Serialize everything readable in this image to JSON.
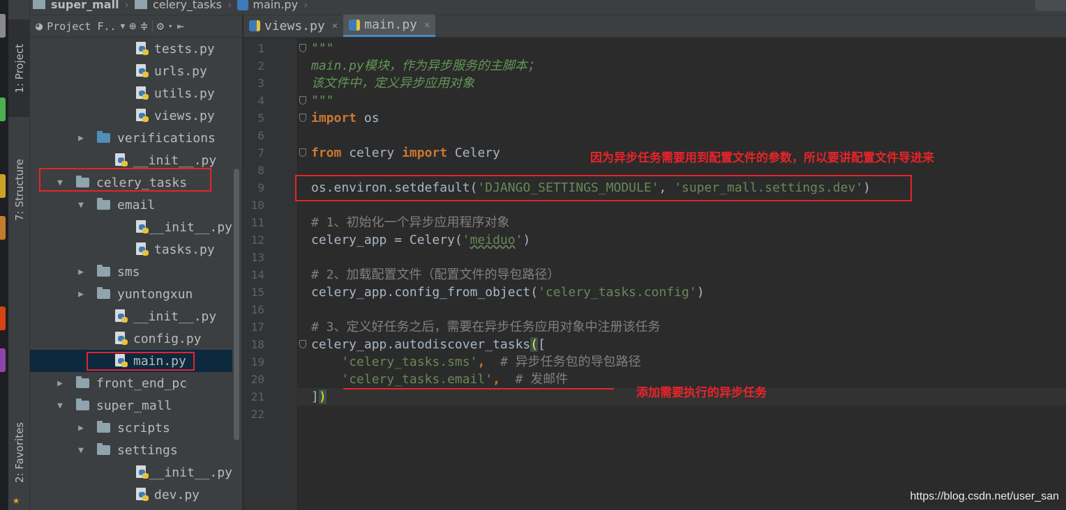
{
  "breadcrumb": [
    "super_mall",
    "celery_tasks",
    "main.py"
  ],
  "side_tabs": [
    "1: Project",
    "7: Structure",
    "2: Favorites"
  ],
  "project_panel": {
    "title": "Project F..",
    "tree": [
      {
        "label": "tests.py",
        "type": "file",
        "depth": 4,
        "expand": ""
      },
      {
        "label": "urls.py",
        "type": "file",
        "depth": 4,
        "expand": ""
      },
      {
        "label": "utils.py",
        "type": "file",
        "depth": 4,
        "expand": ""
      },
      {
        "label": "views.py",
        "type": "file",
        "depth": 4,
        "expand": ""
      },
      {
        "label": "verifications",
        "type": "pkg",
        "depth": 2,
        "expand": "collapsed"
      },
      {
        "label": "__init__.py",
        "type": "file",
        "depth": 3,
        "expand": ""
      },
      {
        "label": "celery_tasks",
        "type": "folder",
        "depth": 1,
        "expand": "expanded"
      },
      {
        "label": "email",
        "type": "folder",
        "depth": 2,
        "expand": "expanded"
      },
      {
        "label": "__init__.py",
        "type": "file",
        "depth": 4,
        "expand": ""
      },
      {
        "label": "tasks.py",
        "type": "file",
        "depth": 4,
        "expand": ""
      },
      {
        "label": "sms",
        "type": "folder",
        "depth": 2,
        "expand": "collapsed"
      },
      {
        "label": "yuntongxun",
        "type": "folder",
        "depth": 2,
        "expand": "collapsed"
      },
      {
        "label": "__init__.py",
        "type": "file",
        "depth": 3,
        "expand": ""
      },
      {
        "label": "config.py",
        "type": "file",
        "depth": 3,
        "expand": ""
      },
      {
        "label": "main.py",
        "type": "file",
        "depth": 3,
        "expand": "",
        "selected": true
      },
      {
        "label": "front_end_pc",
        "type": "folder",
        "depth": 1,
        "expand": "collapsed"
      },
      {
        "label": "super_mall",
        "type": "folder",
        "depth": 1,
        "expand": "expanded"
      },
      {
        "label": "scripts",
        "type": "folder",
        "depth": 2,
        "expand": "collapsed"
      },
      {
        "label": "settings",
        "type": "folder",
        "depth": 2,
        "expand": "expanded"
      },
      {
        "label": "__init__.py",
        "type": "file",
        "depth": 4,
        "expand": ""
      },
      {
        "label": "dev.py",
        "type": "file",
        "depth": 4,
        "expand": ""
      }
    ]
  },
  "editor_tabs": [
    {
      "label": "views.py",
      "active": false
    },
    {
      "label": "main.py",
      "active": true
    }
  ],
  "code": {
    "line_numbers": [
      "1",
      "2",
      "3",
      "4",
      "5",
      "6",
      "7",
      "8",
      "9",
      "10",
      "11",
      "12",
      "13",
      "14",
      "15",
      "16",
      "17",
      "18",
      "19",
      "20",
      "21",
      "22"
    ],
    "lines": [
      [
        {
          "t": "\"\"\"",
          "c": "doc"
        }
      ],
      [
        {
          "t": "main.py模块，作为异步服务的主脚本；",
          "c": "doc"
        }
      ],
      [
        {
          "t": "该文件中，定义异步应用对象",
          "c": "doc"
        }
      ],
      [
        {
          "t": "\"\"\"",
          "c": "doc"
        }
      ],
      [
        {
          "t": "import",
          "c": "kw"
        },
        {
          "t": " os",
          "c": ""
        }
      ],
      [],
      [
        {
          "t": "from",
          "c": "kw"
        },
        {
          "t": " celery ",
          "c": ""
        },
        {
          "t": "import",
          "c": "kw"
        },
        {
          "t": " Celery",
          "c": ""
        }
      ],
      [],
      [
        {
          "t": "os.environ.setdefault(",
          "c": ""
        },
        {
          "t": "'DJANGO_SETTINGS_MODULE'",
          "c": "str"
        },
        {
          "t": ", ",
          "c": ""
        },
        {
          "t": "'super_mall.settings.dev'",
          "c": "str"
        },
        {
          "t": ")",
          "c": ""
        }
      ],
      [],
      [
        {
          "t": "# 1、初始化一个异步应用程序对象",
          "c": "cmt"
        }
      ],
      [
        {
          "t": "celery_app = Celery(",
          "c": ""
        },
        {
          "t": "'",
          "c": "str"
        },
        {
          "t": "meiduo",
          "c": "str underline-wavy"
        },
        {
          "t": "'",
          "c": "str"
        },
        {
          "t": ")",
          "c": ""
        }
      ],
      [],
      [
        {
          "t": "# 2、加载配置文件（配置文件的导包路径）",
          "c": "cmt"
        }
      ],
      [
        {
          "t": "celery_app.config_from_object(",
          "c": ""
        },
        {
          "t": "'celery_tasks.config'",
          "c": "str"
        },
        {
          "t": ")",
          "c": ""
        }
      ],
      [],
      [
        {
          "t": "# 3、定义好任务之后，需要在异步任务应用对象中注册该任务",
          "c": "cmt"
        }
      ],
      [
        {
          "t": "celery_app.autodiscover_tasks",
          "c": ""
        },
        {
          "t": "(",
          "c": "paren-hl"
        },
        {
          "t": "[",
          "c": ""
        }
      ],
      [
        {
          "t": "    ",
          "c": ""
        },
        {
          "t": "'celery_tasks.sms'",
          "c": "str"
        },
        {
          "t": ",  ",
          "c": "kw"
        },
        {
          "t": "# 异步任务包的导包路径",
          "c": "cmt"
        }
      ],
      [
        {
          "t": "    ",
          "c": ""
        },
        {
          "t": "'celery_tasks.email'",
          "c": "str"
        },
        {
          "t": ",  ",
          "c": "kw"
        },
        {
          "t": "# 发邮件",
          "c": "cmt"
        }
      ],
      [
        {
          "t": "]",
          "c": ""
        },
        {
          "t": ")",
          "c": "paren-hl"
        }
      ],
      []
    ]
  },
  "annotations": {
    "note_settings": "因为异步任务需要用到配置文件的参数，所以要讲配置文件导进来",
    "note_tasks": "添加需要执行的异步任务",
    "color": "#e8232a"
  },
  "watermark": "https://blog.csdn.net/user_san"
}
